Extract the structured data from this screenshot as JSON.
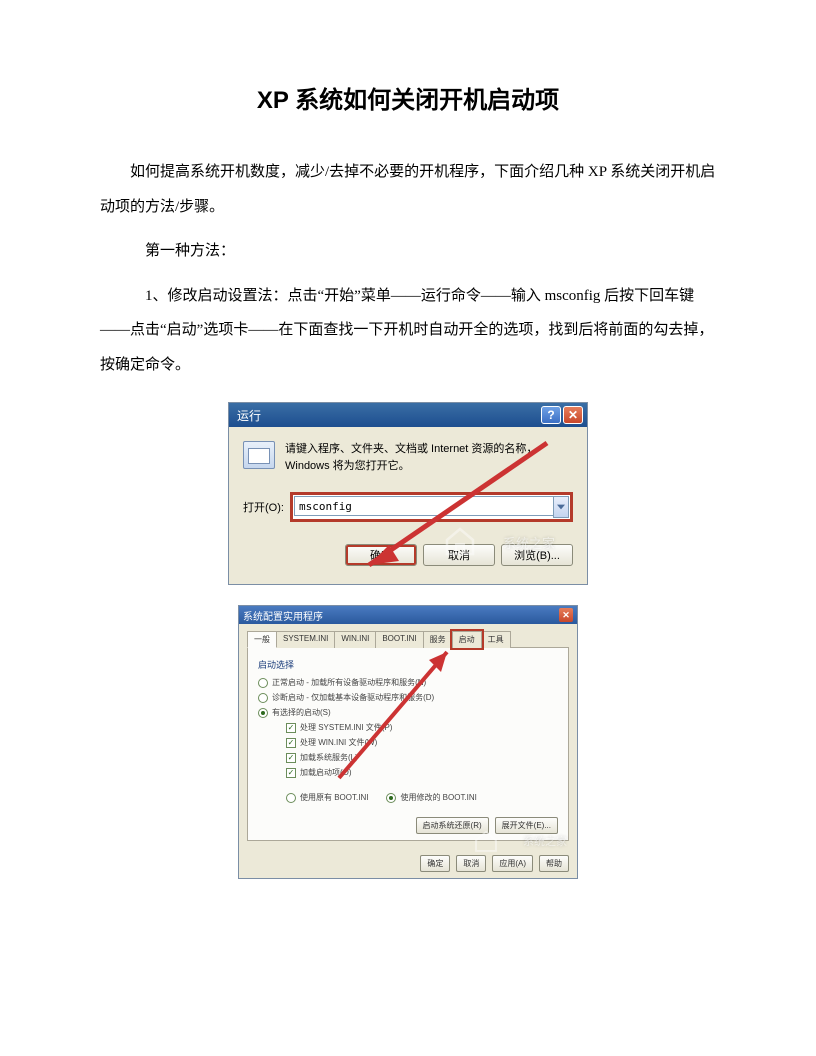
{
  "doc": {
    "title": "XP 系统如何关闭开机启动项",
    "intro": "如何提高系统开机数度，减少/去掉不必要的开机程序，下面介绍几种 XP 系统关闭开机启动项的方法/步骤。",
    "method1_label": "第一种方法：",
    "step1": "1、修改启动设置法：点击“开始”菜单——运行命令——输入 msconfig 后按下回车键——点击“启动”选项卡——在下面查找一下开机时自动开全的选项，找到后将前面的勾去掉，按确定命令。"
  },
  "run": {
    "title": "运行",
    "help_icon": "?",
    "close_icon": "✕",
    "description": "请键入程序、文件夹、文档或 Internet 资源的名称，Windows 将为您打开它。",
    "open_label": "打开(O):",
    "input_value": "msconfig",
    "ok": "确定",
    "cancel": "取消",
    "browse": "浏览(B)...",
    "watermark": "系统之家"
  },
  "msc": {
    "title": "系统配置实用程序",
    "close_icon": "✕",
    "tabs": [
      "一般",
      "SYSTEM.INI",
      "WIN.INI",
      "BOOT.INI",
      "服务",
      "启动",
      "工具"
    ],
    "tab_highlight_index": 5,
    "group_title": "启动选择",
    "radios": [
      {
        "label": "正常启动 - 加载所有设备驱动程序和服务(N)",
        "on": false
      },
      {
        "label": "诊断启动 - 仅加载基本设备驱动程序和服务(D)",
        "on": false
      },
      {
        "label": "有选择的启动(S)",
        "on": true
      }
    ],
    "checks": [
      {
        "label": "处理 SYSTEM.INI 文件(P)",
        "on": true
      },
      {
        "label": "处理 WIN.INI 文件(W)",
        "on": true
      },
      {
        "label": "加载系统服务(L)",
        "on": true
      },
      {
        "label": "加载启动项(O)",
        "on": true
      }
    ],
    "boot_status": [
      {
        "label": "使用原有 BOOT.INI",
        "on": false
      },
      {
        "label": "使用修改的 BOOT.INI",
        "on": true
      }
    ],
    "btn_launch": "启动系统还原(R)",
    "btn_expand": "展开文件(E)...",
    "btn_ok": "确定",
    "btn_cancel": "取消",
    "btn_apply": "应用(A)",
    "btn_help": "帮助"
  }
}
